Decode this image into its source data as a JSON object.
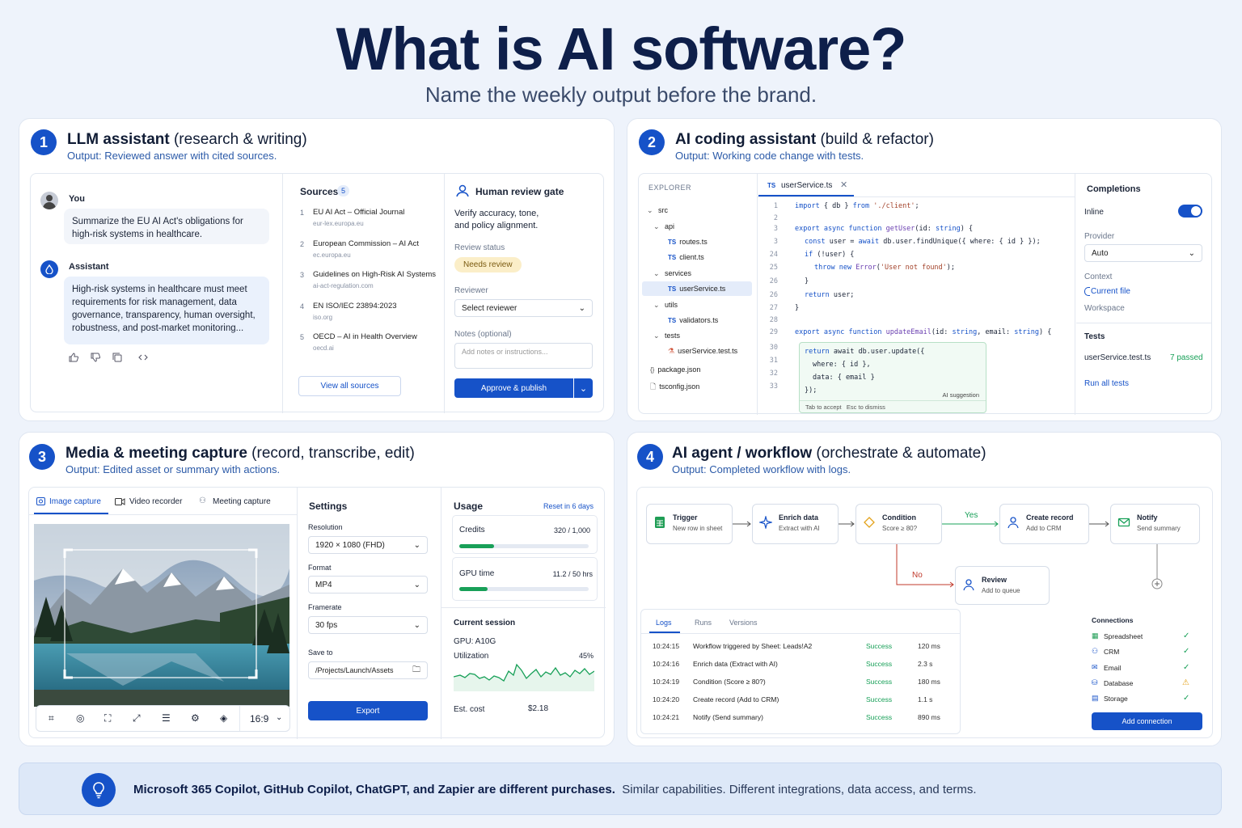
{
  "hero": {
    "title": "What is AI software?",
    "subtitle": "Name the weekly output before the brand."
  },
  "card1": {
    "num": "1",
    "title": "LLM assistant",
    "title_rest": "(research & writing)",
    "output": "Output: Reviewed answer with cited sources.",
    "chat": {
      "user_name": "You",
      "user_msg": "Summarize the EU AI Act's obligations for high-risk systems in healthcare.",
      "assistant_name": "Assistant",
      "assistant_msg": "High-risk systems in healthcare must meet requirements for risk management, data governance, transparency, human oversight, robustness, and post-market monitoring..."
    },
    "sources": {
      "title": "Sources",
      "count": "5",
      "items": [
        {
          "n": "1",
          "title": "EU AI Act – Official Journal",
          "url": "eur-lex.europa.eu"
        },
        {
          "n": "2",
          "title": "European Commission – AI Act",
          "url": "ec.europa.eu"
        },
        {
          "n": "3",
          "title": "Guidelines on High-Risk AI Systems",
          "url": "ai-act-regulation.com"
        },
        {
          "n": "4",
          "title": "EN ISO/IEC 23894:2023",
          "url": "iso.org"
        },
        {
          "n": "5",
          "title": "OECD – AI in Health Overview",
          "url": "oecd.ai"
        }
      ],
      "view_all": "View all sources"
    },
    "review": {
      "title": "Human review gate",
      "desc1": "Verify accuracy, tone,",
      "desc2": "and policy alignment.",
      "status_label": "Review status",
      "status": "Needs review",
      "reviewer_label": "Reviewer",
      "reviewer_placeholder": "Select reviewer",
      "notes_label": "Notes (optional)",
      "notes_placeholder": "Add notes or instructions...",
      "approve": "Approve & publish"
    }
  },
  "card2": {
    "num": "2",
    "title": "AI coding assistant",
    "title_rest": "(build & refactor)",
    "output": "Output: Working code change with tests.",
    "explorer": {
      "title": "EXPLORER",
      "items": [
        "src",
        "api",
        "routes.ts",
        "client.ts",
        "services",
        "userService.ts",
        "utils",
        "validators.ts",
        "tests",
        "userService.test.ts",
        "package.json",
        "tsconfig.json"
      ]
    },
    "tab": "userService.ts",
    "lines": [
      "1",
      "2",
      "3",
      "3",
      "24",
      "25",
      "26",
      "26",
      "27",
      "28",
      "29",
      "30",
      "31",
      "32",
      "33"
    ],
    "suggestion": {
      "label": "AI suggestion",
      "accept": "Tab",
      "accept_text": "to accept",
      "dismiss": "Esc",
      "dismiss_text": "to dismiss"
    },
    "completions": {
      "title": "Completions",
      "inline": "Inline",
      "provider_label": "Provider",
      "provider": "Auto",
      "context_label": "Context",
      "context_value": "Current file",
      "workspace": "Workspace",
      "tests_title": "Tests",
      "test_file": "userService.test.ts",
      "passed": "7 passed",
      "run_all": "Run all tests"
    }
  },
  "card3": {
    "num": "3",
    "title": "Media & meeting capture",
    "title_rest": "(record, transcribe, edit)",
    "output": "Output: Edited asset or summary with actions.",
    "tabs": [
      "Image capture",
      "Video recorder",
      "Meeting capture"
    ],
    "aspect": "16:9",
    "settings": {
      "title": "Settings",
      "resolution_label": "Resolution",
      "resolution": "1920 × 1080 (FHD)",
      "format_label": "Format",
      "format": "MP4",
      "framerate_label": "Framerate",
      "framerate": "30 fps",
      "save_label": "Save to",
      "save_path": "/Projects/Launch/Assets",
      "export": "Export"
    },
    "usage": {
      "title": "Usage",
      "reset": "Reset in 6 days",
      "credits_label": "Credits",
      "credits": "320 / 1,000",
      "credits_frac": 0.32,
      "gpu_label": "GPU time",
      "gpu": "11.2 / 50 hrs",
      "gpu_frac": 0.224,
      "session_title": "Current session",
      "gpu_model": "GPU: A10G",
      "util_label": "Utilization",
      "util": "45%",
      "cost_label": "Est. cost",
      "cost": "$2.18"
    }
  },
  "card4": {
    "num": "4",
    "title": "AI agent / workflow",
    "title_rest": "(orchestrate & automate)",
    "output": "Output: Completed workflow with logs.",
    "nodes": [
      {
        "title": "Trigger",
        "sub": "New row in sheet"
      },
      {
        "title": "Enrich data",
        "sub": "Extract with AI"
      },
      {
        "title": "Condition",
        "sub": "Score ≥ 80?"
      },
      {
        "title": "Create record",
        "sub": "Add to CRM"
      },
      {
        "title": "Notify",
        "sub": "Send summary"
      },
      {
        "title": "Review",
        "sub": "Add to queue"
      }
    ],
    "yes": "Yes",
    "no": "No",
    "log_tabs": [
      "Logs",
      "Runs",
      "Versions"
    ],
    "logs": [
      {
        "time": "10:24:15",
        "msg": "Workflow triggered by Sheet: Leads!A2",
        "status": "Success",
        "dur": "120 ms"
      },
      {
        "time": "10:24:16",
        "msg": "Enrich data (Extract with AI)",
        "status": "Success",
        "dur": "2.3 s"
      },
      {
        "time": "10:24:19",
        "msg": "Condition (Score ≥ 80?)",
        "status": "Success",
        "dur": "180 ms"
      },
      {
        "time": "10:24:20",
        "msg": "Create record (Add to CRM)",
        "status": "Success",
        "dur": "1.1 s"
      },
      {
        "time": "10:24:21",
        "msg": "Notify (Send summary)",
        "status": "Success",
        "dur": "890 ms"
      }
    ],
    "connections": {
      "title": "Connections",
      "items": [
        "Spreadsheet",
        "CRM",
        "Email",
        "Database",
        "Storage"
      ],
      "add": "Add connection"
    }
  },
  "footer": {
    "bold": "Microsoft 365 Copilot, GitHub Copilot, ChatGPT, and Zapier are different purchases.",
    "rest": "Similar capabilities. Different integrations, data access, and terms."
  },
  "colors": {
    "accent": "#1652c8",
    "success": "#18a058",
    "warning": "#e3a21a",
    "title": "#0e1f4a"
  }
}
